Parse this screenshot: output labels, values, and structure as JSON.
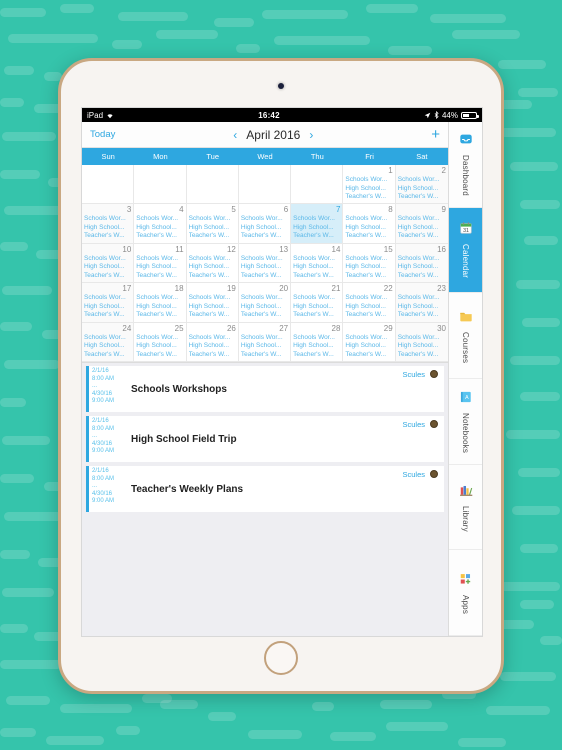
{
  "status_bar": {
    "device": "iPad",
    "wifi_icon": "wifi-icon",
    "time": "16:42",
    "location_icon": "location-arrow-icon",
    "bluetooth_icon": "bluetooth-icon",
    "battery_text": "44%",
    "battery_percent": 44
  },
  "toolbar": {
    "today_label": "Today",
    "prev_icon": "‹",
    "month_label": "April 2016",
    "next_icon": "›",
    "add_icon": "+"
  },
  "calendar": {
    "weekdays": [
      "Sun",
      "Mon",
      "Tue",
      "Wed",
      "Thu",
      "Fri",
      "Sat"
    ],
    "today_day": 7,
    "event_titles": [
      "Schools Wor...",
      "High School...",
      "Teacher's W..."
    ],
    "days": [
      null,
      null,
      null,
      null,
      null,
      1,
      2,
      3,
      4,
      5,
      6,
      7,
      8,
      9,
      10,
      11,
      12,
      13,
      14,
      15,
      16,
      17,
      18,
      19,
      20,
      21,
      22,
      23,
      24,
      25,
      26,
      27,
      28,
      29,
      30
    ]
  },
  "events": [
    {
      "start_date": "2/1/16",
      "start_time": "8:00 AM",
      "separator": "...",
      "end_date": "4/30/16",
      "end_time": "9:00 AM",
      "title": "Schools Workshops",
      "calendar_name": "Scules",
      "avatar_icon": "user-avatar-icon"
    },
    {
      "start_date": "2/1/16",
      "start_time": "8:00 AM",
      "separator": "...",
      "end_date": "4/30/16",
      "end_time": "9:00 AM",
      "title": "High School Field Trip",
      "calendar_name": "Scules",
      "avatar_icon": "user-avatar-icon"
    },
    {
      "start_date": "2/1/16",
      "start_time": "8:00 AM",
      "separator": "...",
      "end_date": "4/30/16",
      "end_time": "9:00 AM",
      "title": "Teacher's Weekly Plans",
      "calendar_name": "Scules",
      "avatar_icon": "user-avatar-icon"
    }
  ],
  "rail": {
    "items": [
      {
        "label": "Dashboard",
        "icon": "dashboard-inbox-icon",
        "active": false
      },
      {
        "label": "Calendar",
        "icon": "calendar-31-icon",
        "active": true
      },
      {
        "label": "Courses",
        "icon": "folder-icon",
        "active": false
      },
      {
        "label": "Notebooks",
        "icon": "notebook-icon",
        "active": false
      },
      {
        "label": "Library",
        "icon": "library-books-icon",
        "active": false
      },
      {
        "label": "Apps",
        "icon": "apps-grid-plus-icon",
        "active": false
      }
    ]
  },
  "colors": {
    "background_teal": "#35c4ab",
    "accent_blue": "#2ea7e0",
    "today_highlight": "#d6eef9",
    "event_text_blue": "#5bb8e8",
    "device_gold": "#c9a882"
  }
}
